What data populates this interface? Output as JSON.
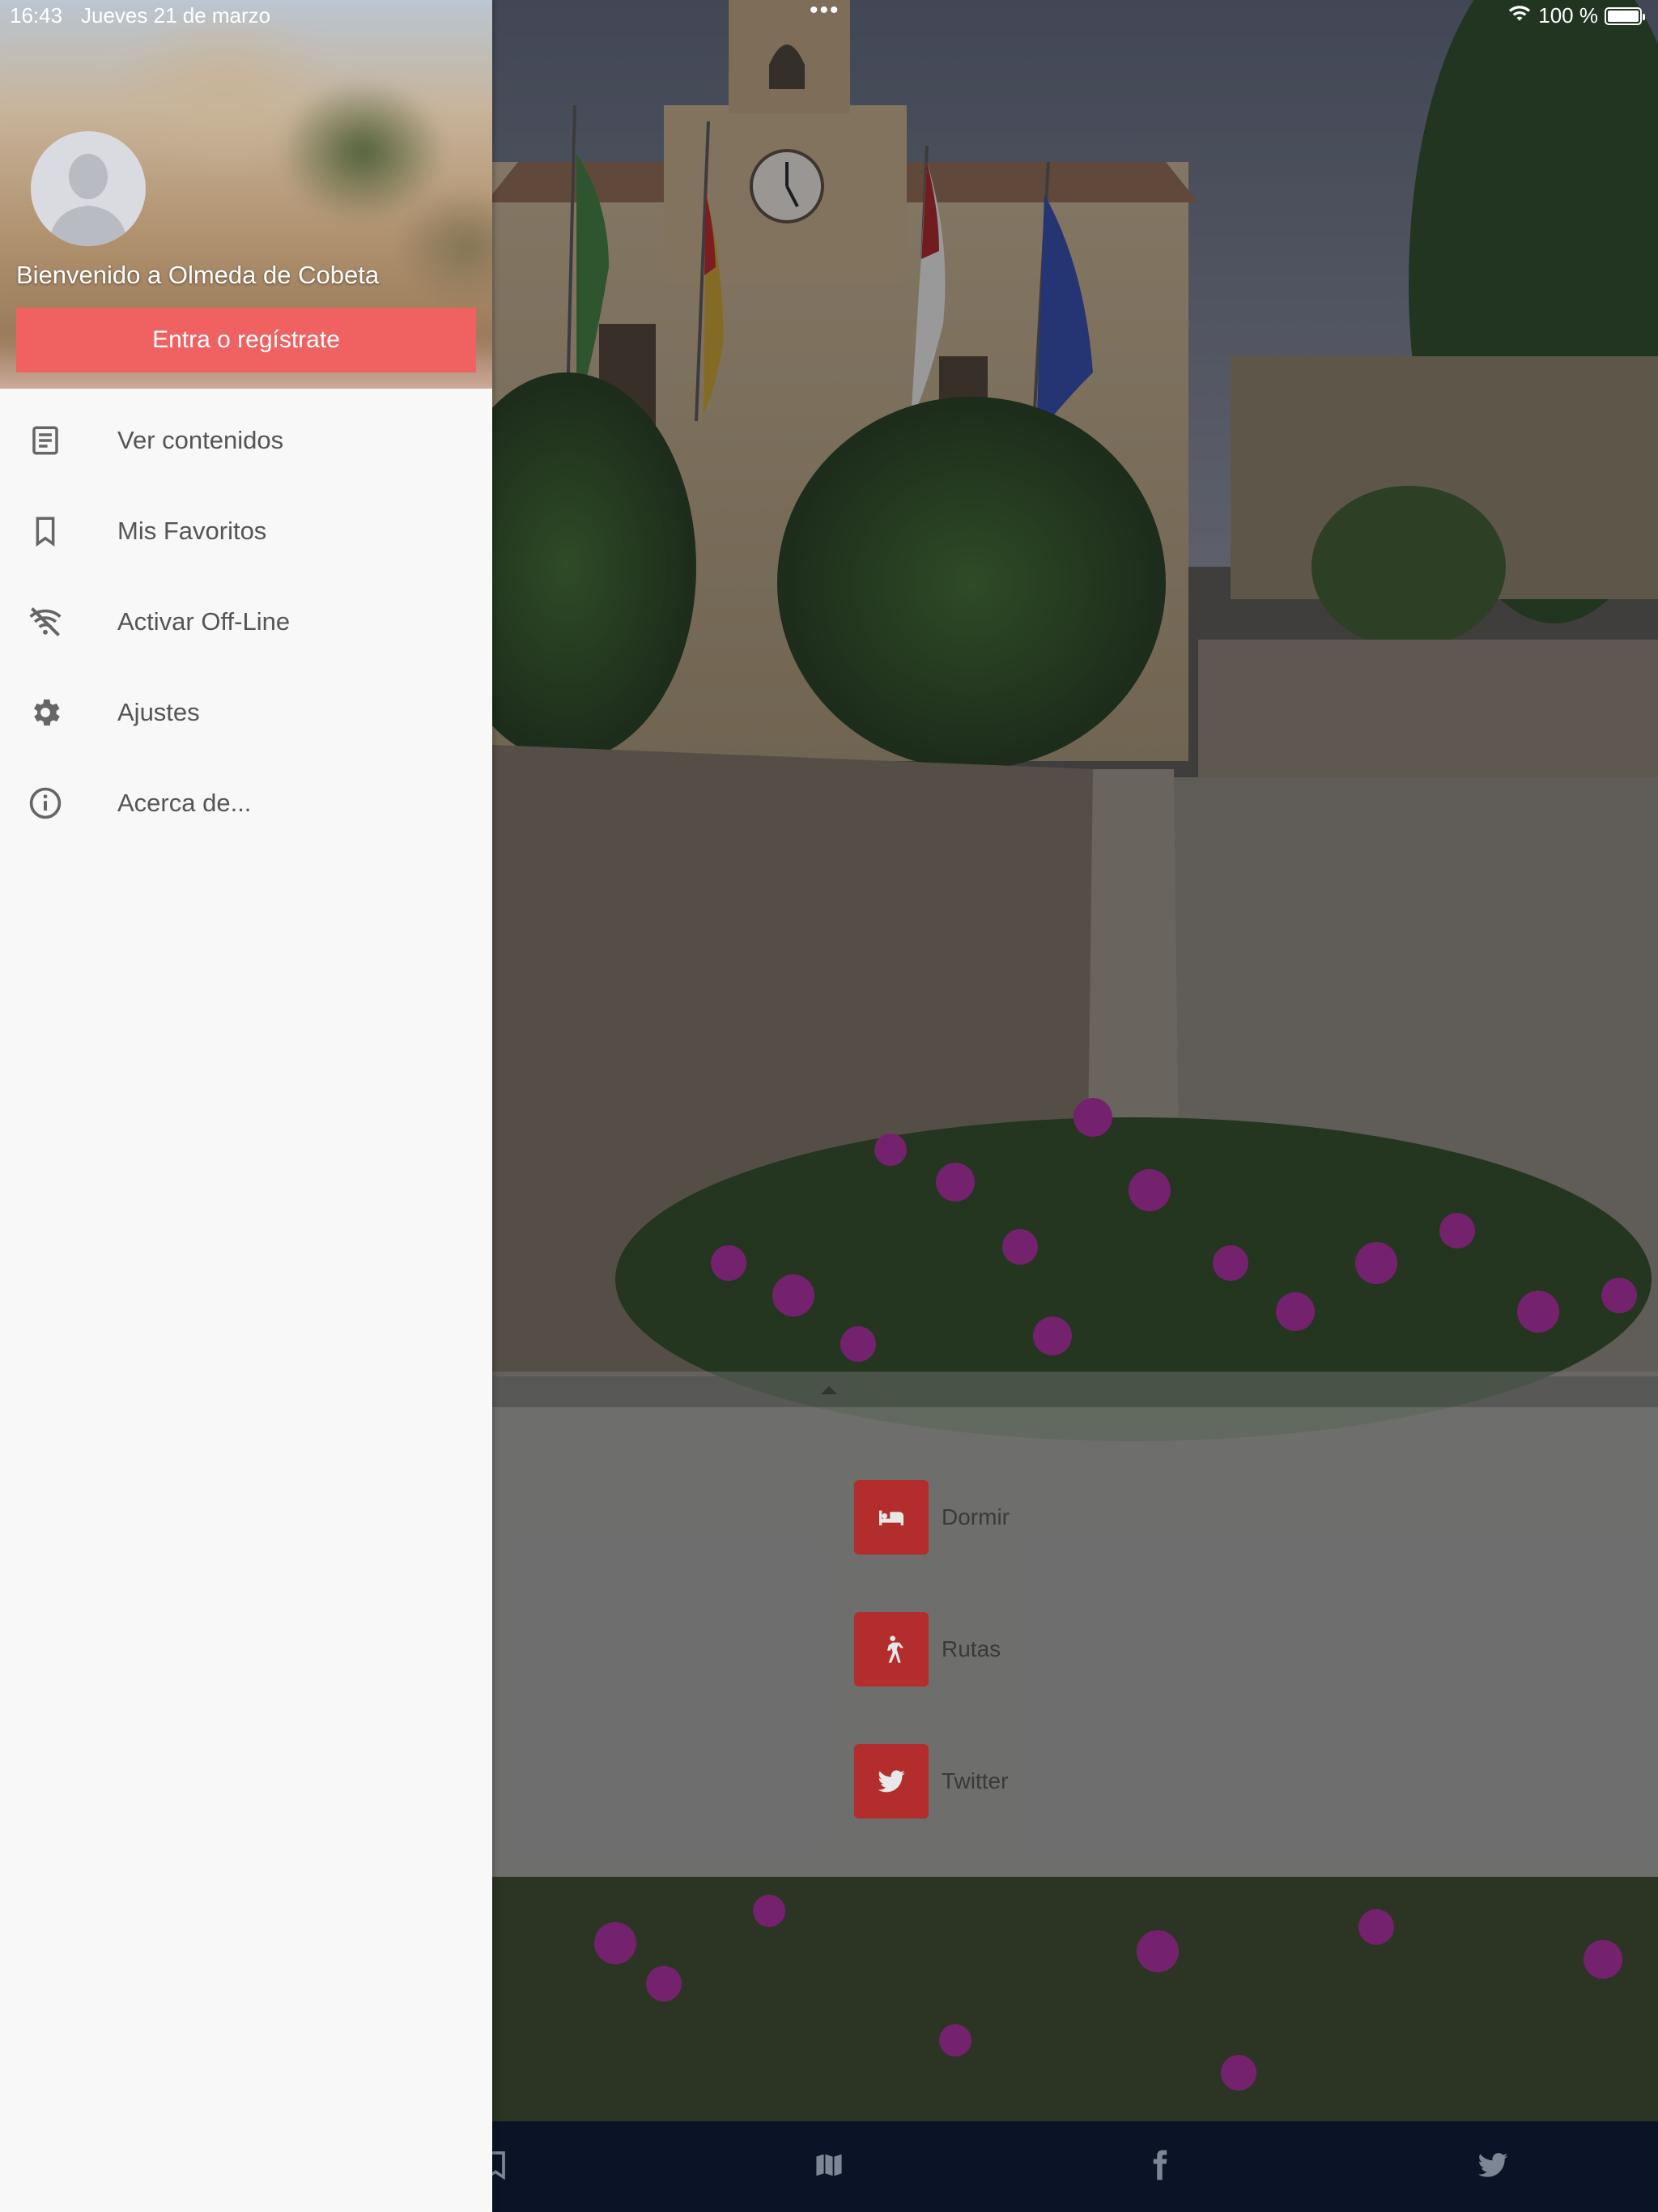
{
  "status_bar": {
    "time": "16:43",
    "date": "Jueves 21 de marzo",
    "battery": "100 %",
    "battery_level": 1.0
  },
  "drawer": {
    "welcome": "Bienvenido a Olmeda de Cobeta",
    "login_label": "Entra o regístrate",
    "items": [
      {
        "label": "Ver contenidos",
        "icon": "article-icon"
      },
      {
        "label": "Mis Favoritos",
        "icon": "bookmark-icon"
      },
      {
        "label": "Activar Off-Line",
        "icon": "wifi-off-icon"
      },
      {
        "label": "Ajustes",
        "icon": "gear-icon"
      },
      {
        "label": "Acerca de...",
        "icon": "info-icon"
      }
    ]
  },
  "quick_actions": [
    {
      "label": "Dormir",
      "icon": "bed-icon"
    },
    {
      "label": "Rutas",
      "icon": "hiking-icon"
    },
    {
      "label": "Twitter",
      "icon": "twitter-icon"
    }
  ],
  "tab_bar": {
    "tabs": [
      "bookmark-icon",
      "map-icon",
      "facebook-icon",
      "twitter-icon"
    ]
  },
  "colors": {
    "accent": "#f06161",
    "tile": "#b32d2d",
    "tab_bar": "#0a1426",
    "drawer_bg": "#f8f8f8"
  }
}
